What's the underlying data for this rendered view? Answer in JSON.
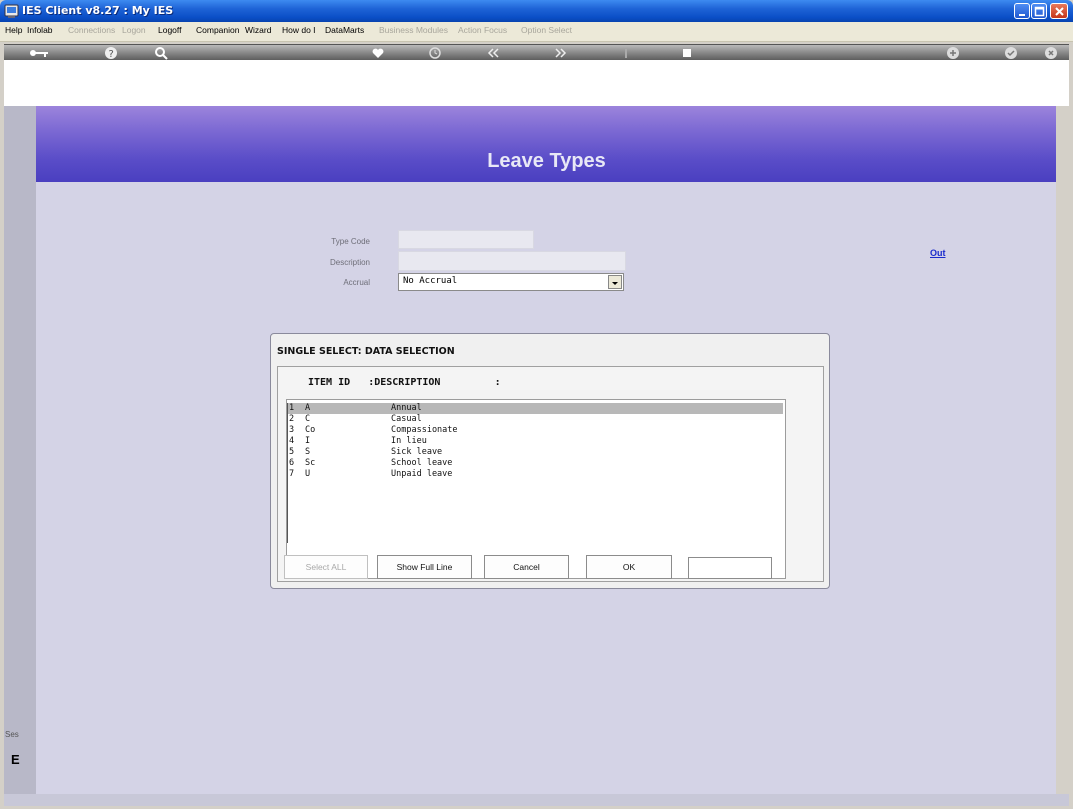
{
  "window": {
    "title": "IES Client v8.27 : My IES"
  },
  "menu": {
    "items": [
      {
        "label": "Help",
        "enabled": true
      },
      {
        "label": "Infolab",
        "enabled": true
      },
      {
        "label": "Connections",
        "enabled": false
      },
      {
        "label": "Logon",
        "enabled": false
      },
      {
        "label": "Logoff",
        "enabled": true
      },
      {
        "label": "Companion",
        "enabled": true
      },
      {
        "label": "Wizard",
        "enabled": true
      },
      {
        "label": "How do I",
        "enabled": true
      },
      {
        "label": "DataMarts",
        "enabled": true
      },
      {
        "label": "Business Modules",
        "enabled": false
      },
      {
        "label": "Action Focus",
        "enabled": false
      },
      {
        "label": "Option Select",
        "enabled": false
      }
    ]
  },
  "toolbar": {
    "icons": [
      "key-icon",
      "help-icon",
      "search-icon",
      "heart-icon",
      "clock-icon",
      "back-icon",
      "forward-icon",
      "info-icon",
      "stop-icon",
      "plus-icon",
      "check-icon",
      "close-icon"
    ]
  },
  "page": {
    "title": "Leave Types",
    "out_link": "Out"
  },
  "form": {
    "type_code_label": "Type Code",
    "description_label": "Description",
    "accrual_label": "Accrual",
    "accrual_value": "No Accrual"
  },
  "dialog": {
    "title": "SINGLE SELECT: DATA SELECTION",
    "header": "ITEM ID   :DESCRIPTION         :",
    "rows": [
      {
        "num": "1",
        "id": "A",
        "description": "Annual"
      },
      {
        "num": "2",
        "id": "C",
        "description": "Casual"
      },
      {
        "num": "3",
        "id": "Co",
        "description": "Compassionate"
      },
      {
        "num": "4",
        "id": "I",
        "description": "In lieu"
      },
      {
        "num": "5",
        "id": "S",
        "description": "Sick leave"
      },
      {
        "num": "6",
        "id": "Sc",
        "description": "School leave"
      },
      {
        "num": "7",
        "id": "U",
        "description": "Unpaid leave"
      }
    ],
    "buttons": {
      "select_all": "Select ALL",
      "show_full_line": "Show Full Line",
      "cancel": "Cancel",
      "ok": "OK"
    }
  },
  "status": {
    "ses_label": "Ses",
    "b_label": "E"
  },
  "colors": {
    "title_bar": "#0a4ec6",
    "banner": "#5a4dc8",
    "work_area": "#d4d3e6",
    "link": "#1a2acc"
  }
}
